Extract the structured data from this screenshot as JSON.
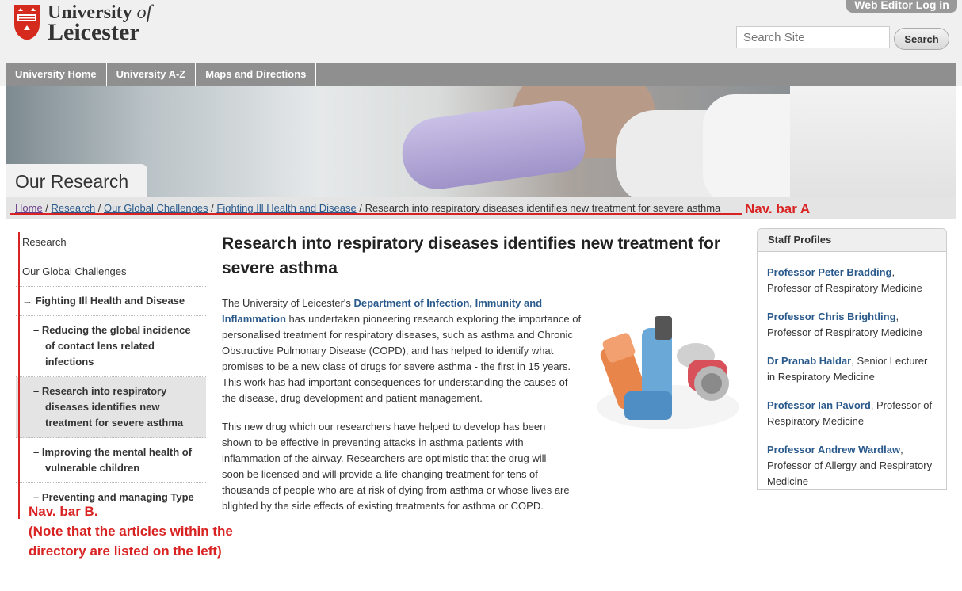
{
  "header": {
    "logo_line1": "University",
    "logo_line1_italic": "of",
    "logo_line2": "Leicester",
    "web_editor_label": "Web Editor Log in",
    "search_placeholder": "Search Site",
    "search_button": "Search"
  },
  "topnav": [
    "University Home",
    "University A-Z",
    "Maps and Directions"
  ],
  "banner": {
    "title": "Our Research"
  },
  "breadcrumb": {
    "items": [
      "Home",
      "Research",
      "Our Global Challenges",
      "Fighting Ill Health and Disease"
    ],
    "current": "Research into respiratory diseases identifies new treatment for severe asthma",
    "annotation": "Nav. bar A"
  },
  "leftnav": {
    "items": [
      "Research",
      "Our Global Challenges",
      "→ Fighting Ill Health and Disease",
      "– Reducing the global incidence of contact lens related infections",
      "– Research into respiratory diseases identifies new treatment for severe asthma",
      "– Improving the mental health of vulnerable children",
      "– Preventing and managing Type"
    ],
    "annotation_line1": "Nav. bar B.",
    "annotation_line2": "(Note that the articles within the",
    "annotation_line3": "directory are listed on the left)"
  },
  "article": {
    "title": "Research into respiratory diseases identifies new treatment for severe asthma",
    "p1_start": "The University of Leicester's ",
    "p1_link": "Department of Infection, Immunity and Inflammation",
    "p1_rest": " has undertaken pioneering research exploring the importance of personalised treatment for respiratory diseases, such as asthma and Chronic Obstructive Pulmonary Disease (COPD), and has helped to identify what promises to be a new class of drugs for severe asthma - the first in 15 years. This work has had important consequences for understanding the causes of the disease, drug development and patient management.",
    "p2": "This new drug which our researchers have helped to develop has been shown to be effective in preventing attacks in asthma patients with inflammation of the airway. Researchers are optimistic that the drug will soon be licensed and will provide a life-changing treatment for tens of thousands of people who are at risk of dying from asthma or whose lives are blighted by the side effects of existing treatments for asthma or COPD."
  },
  "staff": {
    "heading": "Staff Profiles",
    "people": [
      {
        "name": "Professor Peter Bradding",
        "role": "Professor of Respiratory Medicine"
      },
      {
        "name": "Professor Chris Brightling",
        "role": "Professor of Respiratory Medicine"
      },
      {
        "name": "Dr Pranab Haldar",
        "role": "Senior Lecturer in Respiratory Medicine"
      },
      {
        "name": "Professor Ian Pavord",
        "role": "Professor of Respiratory Medicine"
      },
      {
        "name": "Professor Andrew Wardlaw",
        "role": "Professor of Allergy and Respiratory Medicine"
      }
    ]
  }
}
